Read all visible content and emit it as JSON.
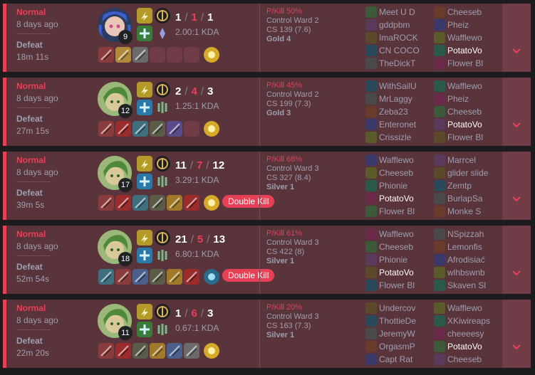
{
  "colors": {
    "defeat_bg": "#59343b",
    "defeat_accent": "#e84057",
    "expand_bg": "#703c47",
    "text_muted": "#9e9eb1"
  },
  "matches": [
    {
      "mode": "Normal",
      "time_ago": "8 days ago",
      "result": "Defeat",
      "duration": "18m 11s",
      "champion_icon": "jinx-portrait",
      "level": "9",
      "kills": "1",
      "deaths": "1",
      "assists": "1",
      "kda_ratio": "2.00:1 KDA",
      "pkill": "P/Kill 50%",
      "control_ward": "Control Ward 2",
      "cs": "CS 139 (7.6)",
      "tier": "Gold 4",
      "badge": "",
      "spells": [
        "flash-icon",
        "heal-icon"
      ],
      "runes": [
        "lethal-tempo-rune",
        "sorcery-rune"
      ],
      "items": [
        "item-a",
        "item-b",
        "item-c",
        "",
        "",
        ""
      ],
      "team_blue": [
        "Meet U D",
        "gddpbm",
        "ImaROCK",
        "CN COCO",
        "TheDickT"
      ],
      "team_red": [
        "Cheeseb",
        "Pheiz",
        "Wafflewo",
        "PotatoVo",
        "Flower Bl"
      ],
      "me_team": "red",
      "me_index": 3
    },
    {
      "mode": "Normal",
      "time_ago": "8 days ago",
      "result": "Defeat",
      "duration": "27m 15s",
      "champion_icon": "neeko-portrait",
      "level": "12",
      "kills": "2",
      "deaths": "4",
      "assists": "3",
      "kda_ratio": "1.25:1 KDA",
      "pkill": "P/Kill 45%",
      "control_ward": "Control Ward 2",
      "cs": "CS 199 (7.3)",
      "tier": "Gold 3",
      "badge": "",
      "spells": [
        "flash-icon",
        "cleanse-icon"
      ],
      "runes": [
        "lethal-tempo-rune",
        "resolve-rune"
      ],
      "items": [
        "item-a",
        "item-d",
        "item-e",
        "item-f",
        "item-g",
        ""
      ],
      "team_blue": [
        "WithSailU",
        "MrLaggy",
        "Zeba23",
        "Enteronet",
        "Crissizle"
      ],
      "team_red": [
        "Wafflewo",
        "Pheiz",
        "Cheeseb",
        "PotatoVo",
        "Flower Bl"
      ],
      "me_team": "red",
      "me_index": 3
    },
    {
      "mode": "Normal",
      "time_ago": "8 days ago",
      "result": "Defeat",
      "duration": "39m 5s",
      "champion_icon": "neeko-portrait",
      "level": "17",
      "kills": "11",
      "deaths": "7",
      "assists": "12",
      "kda_ratio": "3.29:1 KDA",
      "pkill": "P/Kill 68%",
      "control_ward": "Control Ward 3",
      "cs": "CS 327 (8.4)",
      "tier": "Silver 1",
      "badge": "Double Kill",
      "spells": [
        "flash-icon",
        "cleanse-icon"
      ],
      "runes": [
        "lethal-tempo-rune",
        "resolve-rune"
      ],
      "items": [
        "item-a",
        "item-d",
        "item-e",
        "item-f",
        "item-h",
        "item-d"
      ],
      "team_blue": [
        "Wafflewo",
        "Cheeseb",
        "Phionie",
        "PotatoVo",
        "Flower Bl"
      ],
      "team_red": [
        "Marrcel",
        "glider slide",
        "Zemtp",
        "BurlapSa",
        "Monke S"
      ],
      "me_team": "blue",
      "me_index": 3
    },
    {
      "mode": "Normal",
      "time_ago": "8 days ago",
      "result": "Defeat",
      "duration": "52m 54s",
      "champion_icon": "neeko-portrait",
      "level": "18",
      "kills": "21",
      "deaths": "5",
      "assists": "13",
      "kda_ratio": "6.80:1 KDA",
      "pkill": "P/Kill 61%",
      "control_ward": "Control Ward 3",
      "cs": "CS 422 (8)",
      "tier": "Silver 1",
      "badge": "Double Kill",
      "spells": [
        "flash-icon",
        "cleanse-icon"
      ],
      "runes": [
        "lethal-tempo-rune",
        "resolve-rune"
      ],
      "items": [
        "item-e",
        "item-a",
        "item-i",
        "item-f",
        "item-h",
        "item-d"
      ],
      "team_blue": [
        "Wafflewo",
        "Cheeseb",
        "Phionie",
        "PotatoVo",
        "Flower Bl"
      ],
      "team_red": [
        "NSpizzah",
        "Lemonfis",
        "Afrodisiać",
        "wlhbswnb",
        "Skaven Sl"
      ],
      "me_team": "blue",
      "me_index": 3
    },
    {
      "mode": "Normal",
      "time_ago": "8 days ago",
      "result": "Defeat",
      "duration": "22m 20s",
      "champion_icon": "neeko-portrait",
      "level": "11",
      "kills": "1",
      "deaths": "6",
      "assists": "3",
      "kda_ratio": "0.67:1 KDA",
      "pkill": "P/Kill 20%",
      "control_ward": "Control Ward 3",
      "cs": "CS 163 (7.3)",
      "tier": "Silver 1",
      "badge": "",
      "spells": [
        "flash-icon",
        "heal-icon"
      ],
      "runes": [
        "lethal-tempo-rune",
        "resolve-rune"
      ],
      "items": [
        "item-a",
        "item-d",
        "item-f",
        "item-h",
        "item-i",
        "item-c"
      ],
      "team_blue": [
        "Undercov",
        "ThottieDe",
        "JeremyW",
        "OrgasmP",
        "Capt Rat"
      ],
      "team_red": [
        "Wafflewo",
        "XKiwireaps",
        "cheeeesy",
        "PotatoVo",
        "Cheeseb"
      ],
      "me_team": "red",
      "me_index": 3
    }
  ]
}
